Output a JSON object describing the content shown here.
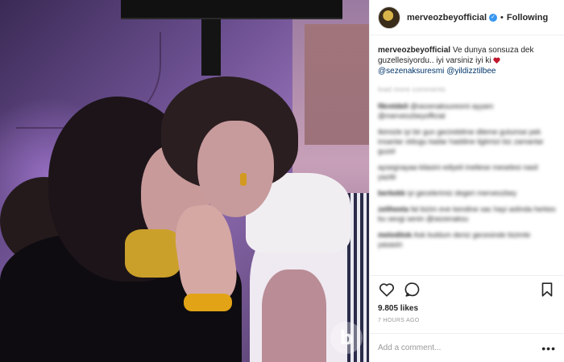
{
  "header": {
    "username": "merveozbeyofficial",
    "separator": "•",
    "follow_label": "Following"
  },
  "caption": {
    "username": "merveozbeyofficial",
    "text": "Ve dunya sonsuza dek guzellesiyordu.. iyi varsiniz iyi ki",
    "mention1": "@sezenaksuresmi",
    "mention2": "@yildizztilbee"
  },
  "load_more": "load more comments",
  "comments": [
    {
      "user": "fikretdeli",
      "text": "@sezenaksuresmi ayyam @merveozbeyofficial"
    },
    {
      "user": "",
      "text": "Ikimizle iyi bir gun gecirebilme dileme gulumse pek insanlar oldugu kadar haddine ilgiimizi biz zamanlar guzel"
    },
    {
      "user": "",
      "text": "aysegnayaa kilasini ediyeli inetlese meselesi nasil yazilir"
    },
    {
      "user": "berkekk",
      "text": "iyi gecelerimiz degeri merveozbey"
    },
    {
      "user": "zeliheeta",
      "text": "fal bizim eve kendine sac hayi aslinda herkes bu sevgi senin @sezenaksu"
    },
    {
      "user": "melodiiok",
      "text": "Ask buldum deniz gecesinde bizimle yasasin"
    }
  ],
  "actions": {
    "like_icon": "heart-icon",
    "comment_icon": "comment-icon",
    "save_icon": "bookmark-icon"
  },
  "likes": "9.805 likes",
  "time": "7 HOURS AGO",
  "add_comment": {
    "placeholder": "Add a comment...",
    "more_label": "•••"
  },
  "photo": {
    "watermark": "b"
  },
  "colors": {
    "verified": "#3897f0",
    "mention": "#003569",
    "muted": "#999999"
  }
}
